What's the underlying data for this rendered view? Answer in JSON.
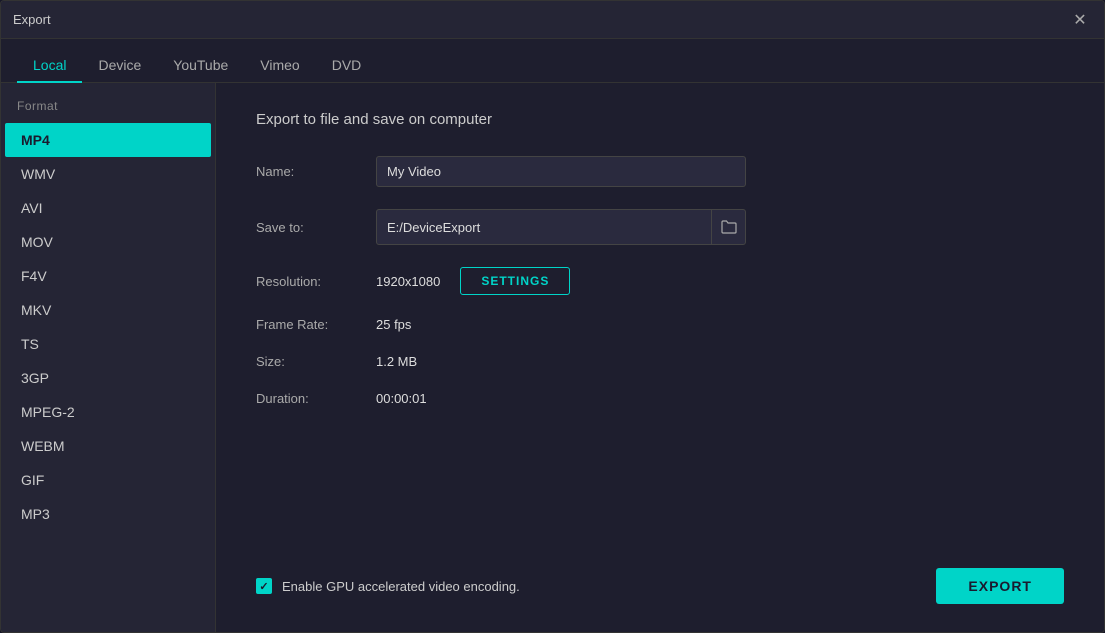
{
  "window": {
    "title": "Export"
  },
  "tabs": [
    {
      "id": "local",
      "label": "Local",
      "active": true
    },
    {
      "id": "device",
      "label": "Device",
      "active": false
    },
    {
      "id": "youtube",
      "label": "YouTube",
      "active": false
    },
    {
      "id": "vimeo",
      "label": "Vimeo",
      "active": false
    },
    {
      "id": "dvd",
      "label": "DVD",
      "active": false
    }
  ],
  "sidebar": {
    "section_label": "Format",
    "items": [
      {
        "id": "mp4",
        "label": "MP4",
        "active": true
      },
      {
        "id": "wmv",
        "label": "WMV",
        "active": false
      },
      {
        "id": "avi",
        "label": "AVI",
        "active": false
      },
      {
        "id": "mov",
        "label": "MOV",
        "active": false
      },
      {
        "id": "f4v",
        "label": "F4V",
        "active": false
      },
      {
        "id": "mkv",
        "label": "MKV",
        "active": false
      },
      {
        "id": "ts",
        "label": "TS",
        "active": false
      },
      {
        "id": "3gp",
        "label": "3GP",
        "active": false
      },
      {
        "id": "mpeg2",
        "label": "MPEG-2",
        "active": false
      },
      {
        "id": "webm",
        "label": "WEBM",
        "active": false
      },
      {
        "id": "gif",
        "label": "GIF",
        "active": false
      },
      {
        "id": "mp3",
        "label": "MP3",
        "active": false
      }
    ]
  },
  "main": {
    "title": "Export to file and save on computer",
    "name_label": "Name:",
    "name_value": "My Video",
    "save_to_label": "Save to:",
    "save_to_value": "E:/DeviceExport",
    "resolution_label": "Resolution:",
    "resolution_value": "1920x1080",
    "settings_button": "SETTINGS",
    "frame_rate_label": "Frame Rate:",
    "frame_rate_value": "25 fps",
    "size_label": "Size:",
    "size_value": "1.2 MB",
    "duration_label": "Duration:",
    "duration_value": "00:00:01",
    "gpu_label": "Enable GPU accelerated video encoding.",
    "export_button": "EXPORT"
  },
  "icons": {
    "close": "✕",
    "folder": "🗀"
  }
}
